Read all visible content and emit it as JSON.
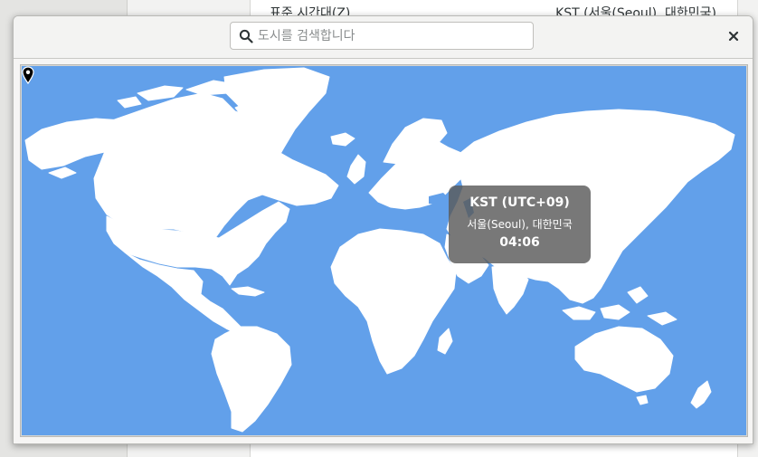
{
  "background": {
    "row_label": "표준 시간대(Z)",
    "row_value": "KST (서울(Seoul), 대한민국)"
  },
  "search": {
    "placeholder": "도시를 검색합니다",
    "value": ""
  },
  "selected_zone": {
    "abbrev": "KST (UTC+09)",
    "city": "서울(Seoul), 대한민국",
    "time": "04:06"
  },
  "colors": {
    "ocean": "#62a0ea",
    "land": "#ffffff",
    "tooltip": "#5a5a5a"
  },
  "icons": {
    "search": "search-icon",
    "close": "close-icon",
    "pin": "location-pin-icon"
  }
}
